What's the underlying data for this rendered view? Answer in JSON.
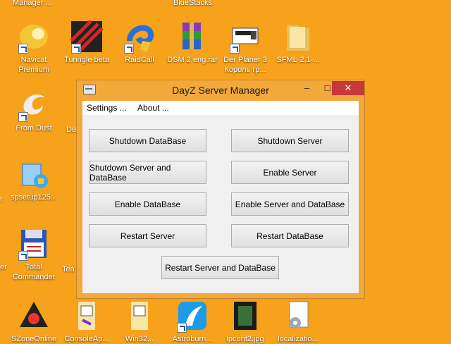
{
  "desktop": {
    "top_labels": [
      "Manager ...",
      "BlueStacks"
    ],
    "icons": [
      {
        "label": "Navicat Premium",
        "icon": "navicat-icon"
      },
      {
        "label": "Tunngle beta",
        "icon": "tunngle-icon"
      },
      {
        "label": "RaidCall",
        "icon": "raidcall-icon"
      },
      {
        "label": "DSM 2 eng.rar",
        "icon": "winrar-archive-icon"
      },
      {
        "label": "Der Planer 3 Король гр...",
        "icon": "der-planer-icon"
      },
      {
        "label": "SFML-2.1-...",
        "icon": "folder-icon"
      },
      {
        "label": "From Dust",
        "icon": "from-dust-icon"
      },
      {
        "label": "spsetup125...",
        "icon": "setup-icon"
      },
      {
        "label": "Total Commander",
        "icon": "floppy-disk-icon"
      },
      {
        "label": "SZoneOnline",
        "icon": "szone-icon"
      },
      {
        "label": "ConsoleAp...",
        "icon": "vs-project-icon"
      },
      {
        "label": "Win32...",
        "icon": "vs-project-icon"
      },
      {
        "label": "Astroburn...",
        "icon": "astroburn-icon"
      },
      {
        "label": "lpconf2.jpg",
        "icon": "image-file-icon"
      },
      {
        "label": "localizatio...",
        "icon": "config-file-icon"
      }
    ],
    "partial_labels": [
      "er",
      "De",
      "r",
      "Tea"
    ]
  },
  "window": {
    "title": "DayZ Server Manager",
    "app_icon": "dzm-app-icon",
    "controls": {
      "minimize": "–",
      "maximize": "□",
      "close": "✕"
    },
    "menu": [
      "Settings ...",
      "About ..."
    ],
    "buttons": {
      "shutdown_database": "Shutdown DataBase",
      "shutdown_server": "Shutdown Server",
      "shutdown_server_and_database": "Shutdown Server and DataBase",
      "enable_server": "Enable Server",
      "enable_database": "Enable DataBase",
      "enable_server_and_database": "Enable Server and DataBase",
      "restart_server": "Restart Server",
      "restart_database": "Restart DataBase",
      "restart_server_and_database": "Restart Server and DataBase"
    }
  },
  "colors": {
    "desktop_bg": "#f7a21b",
    "window_frame": "#f3a83a",
    "close_button": "#c7383a"
  }
}
